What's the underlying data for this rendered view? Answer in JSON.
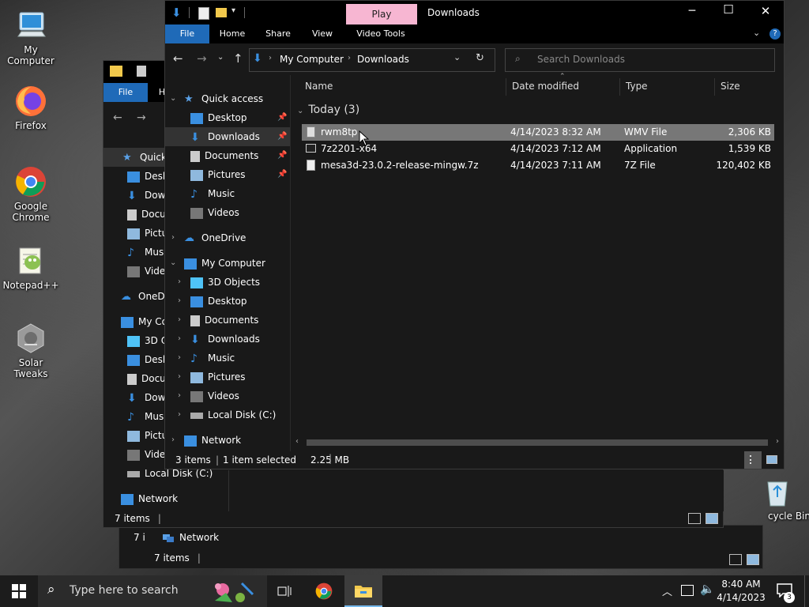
{
  "desktop": {
    "icons": [
      {
        "label": "My Computer"
      },
      {
        "label": "Firefox"
      },
      {
        "label": "Google Chrome"
      },
      {
        "label": "Notepad++"
      },
      {
        "label": "Solar Tweaks"
      },
      {
        "label": "cycle Bin"
      }
    ]
  },
  "back_window2": {
    "tab_file": "File",
    "tab_h": "H",
    "items": [
      "Quick",
      "Desk",
      "Dow",
      "Docu",
      "Pictu",
      "Musi",
      "Vide",
      "OneDr",
      "My Co",
      "3D O",
      "Desk",
      "Docu",
      "Dow",
      "Musi",
      "Pictu",
      "Vide",
      "Local Disk (C:)",
      "Network"
    ],
    "status": "7 items"
  },
  "back_window3": {
    "network": "Network",
    "status_partial": "7 i",
    "status": "7 items"
  },
  "explorer": {
    "ribbon_context": "Play",
    "title": "Downloads",
    "tabs": {
      "file": "File",
      "home": "Home",
      "share": "Share",
      "view": "View",
      "video_tools": "Video Tools"
    },
    "breadcrumb": {
      "root": "My Computer",
      "current": "Downloads"
    },
    "search_placeholder": "Search Downloads",
    "sidebar": {
      "quick_access": "Quick access",
      "qa_items": [
        "Desktop",
        "Downloads",
        "Documents",
        "Pictures",
        "Music",
        "Videos"
      ],
      "onedrive": "OneDrive",
      "my_computer": "My Computer",
      "mc_items": [
        "3D Objects",
        "Desktop",
        "Documents",
        "Downloads",
        "Music",
        "Pictures",
        "Videos",
        "Local Disk (C:)"
      ],
      "network": "Network"
    },
    "columns": {
      "name": "Name",
      "date": "Date modified",
      "type": "Type",
      "size": "Size"
    },
    "group": "Today (3)",
    "files": [
      {
        "name": "rwm8tp",
        "date": "4/14/2023 8:32 AM",
        "type": "WMV File",
        "size": "2,306 KB"
      },
      {
        "name": "7z2201-x64",
        "date": "4/14/2023 7:12 AM",
        "type": "Application",
        "size": "1,539 KB"
      },
      {
        "name": "mesa3d-23.0.2-release-mingw.7z",
        "date": "4/14/2023 7:11 AM",
        "type": "7Z File",
        "size": "120,402 KB"
      }
    ],
    "status": {
      "count": "3 items",
      "selected": "1 item selected",
      "size": "2.25 MB"
    }
  },
  "taskbar": {
    "search_placeholder": "Type here to search",
    "time": "8:40 AM",
    "date": "4/14/2023",
    "notification_count": "3"
  }
}
